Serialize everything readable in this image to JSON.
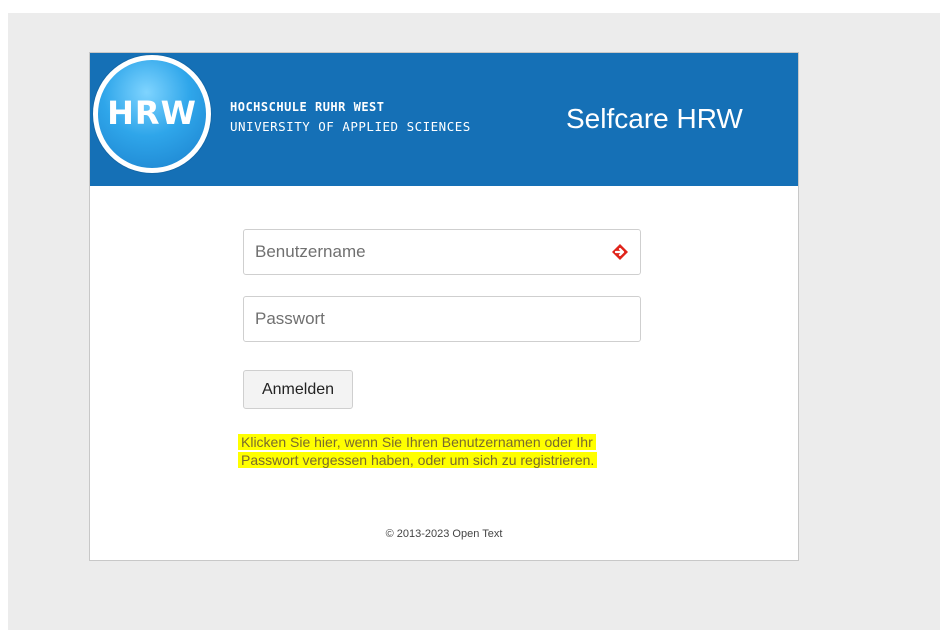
{
  "header": {
    "logo_text": "HRW",
    "university_name": "HOCHSCHULE RUHR WEST",
    "university_subtitle": "UNIVERSITY OF APPLIED SCIENCES",
    "app_title": "Selfcare HRW"
  },
  "login": {
    "username_placeholder": "Benutzername",
    "username_value": "",
    "password_placeholder": "Passwort",
    "password_value": "",
    "submit_label": "Anmelden",
    "help_link_text": "Klicken Sie hier, wenn Sie Ihren Benutzernamen oder Ihr Passwort vergessen haben, oder um sich zu registrieren."
  },
  "footer": {
    "copyright": "© 2013-2023 Open Text"
  },
  "icons": {
    "username_field_icon": "password-manager-icon"
  },
  "colors": {
    "header_bg": "#1570b6",
    "highlight": "#ffff00",
    "icon_red": "#e0241b"
  }
}
